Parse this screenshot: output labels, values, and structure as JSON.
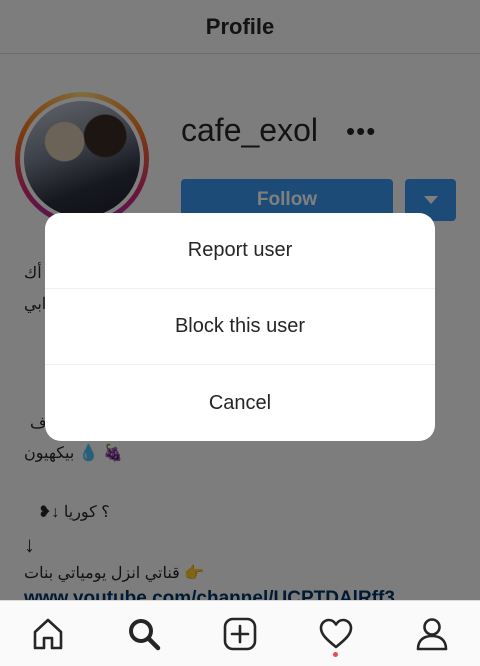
{
  "header": {
    "title": "Profile"
  },
  "profile": {
    "username": "cafe_exol",
    "more": "•••",
    "follow_label": "Follow",
    "bio_lines": [
      "أك",
      "ابي",
      "ف",
      "بيكهيون 💧 🍇",
      "❥↓ ؟ كوريا",
      "↓",
      "قناتي انزل يومياتي بنات 👉"
    ],
    "bio_link": "www.youtube.com/channel/UCPTDAlRff3..."
  },
  "dialog": {
    "items": [
      "Report user",
      "Block this user",
      "Cancel"
    ]
  },
  "tabbar": {
    "icons": [
      "home-icon",
      "search-icon",
      "add-post-icon",
      "activity-heart-icon",
      "profile-icon"
    ]
  }
}
